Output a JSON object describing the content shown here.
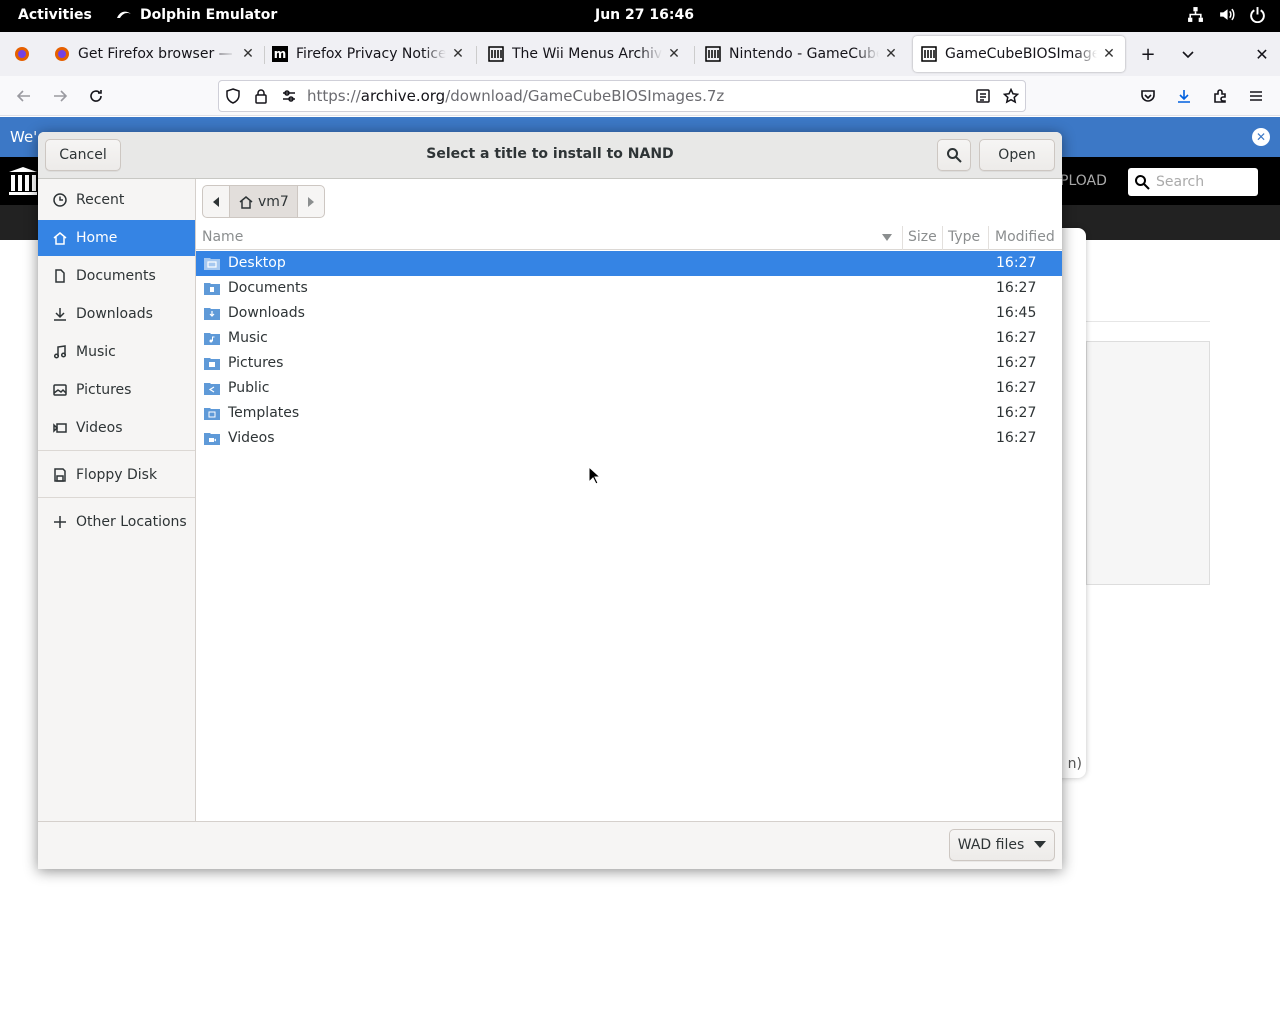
{
  "topbar": {
    "activities": "Activities",
    "app_name": "Dolphin Emulator",
    "clock": "Jun 27  16:46",
    "tray_icons": [
      "network-icon",
      "volume-icon",
      "power-icon"
    ]
  },
  "browser": {
    "tabs": [
      {
        "title": "Get Firefox browser — M",
        "icon": "firefox-icon",
        "active": false
      },
      {
        "title": "Firefox Privacy Notice —",
        "icon": "mozilla-m-icon",
        "active": false
      },
      {
        "title": "The Wii Menus Archive (",
        "icon": "archive-org-icon",
        "active": false
      },
      {
        "title": "Nintendo - GameCube -",
        "icon": "archive-org-icon",
        "active": false
      },
      {
        "title": "GameCubeBIOSImages.",
        "icon": "archive-org-icon",
        "active": true
      }
    ],
    "url_prefix": "https://",
    "url_host": "archive.org",
    "url_path": "/download/GameCubeBIOSImages.7z"
  },
  "page": {
    "notice_text": "We'",
    "upload_fragment": "PLOAD",
    "search_placeholder": "Search",
    "card_fragment": "n)"
  },
  "dialog": {
    "title": "Select a title to install to NAND",
    "cancel_label": "Cancel",
    "open_label": "Open",
    "sidebar": [
      {
        "label": "Recent",
        "icon": "clock-icon",
        "selected": false
      },
      {
        "label": "Home",
        "icon": "home-icon",
        "selected": true
      },
      {
        "label": "Documents",
        "icon": "document-icon",
        "selected": false
      },
      {
        "label": "Downloads",
        "icon": "download-icon",
        "selected": false
      },
      {
        "label": "Music",
        "icon": "music-icon",
        "selected": false
      },
      {
        "label": "Pictures",
        "icon": "picture-icon",
        "selected": false
      },
      {
        "label": "Videos",
        "icon": "video-icon",
        "selected": false
      },
      {
        "label": "Floppy Disk",
        "icon": "floppy-icon",
        "selected": false
      },
      {
        "label": "Other Locations",
        "icon": "plus-icon",
        "selected": false
      }
    ],
    "path": "vm7",
    "columns": {
      "name": "Name",
      "size": "Size",
      "type": "Type",
      "modified": "Modified"
    },
    "files": [
      {
        "name": "Desktop",
        "modified": "16:27",
        "selected": true
      },
      {
        "name": "Documents",
        "modified": "16:27",
        "selected": false
      },
      {
        "name": "Downloads",
        "modified": "16:45",
        "selected": false
      },
      {
        "name": "Music",
        "modified": "16:27",
        "selected": false
      },
      {
        "name": "Pictures",
        "modified": "16:27",
        "selected": false
      },
      {
        "name": "Public",
        "modified": "16:27",
        "selected": false
      },
      {
        "name": "Templates",
        "modified": "16:27",
        "selected": false
      },
      {
        "name": "Videos",
        "modified": "16:27",
        "selected": false
      }
    ],
    "filter": "WAD files"
  },
  "colors": {
    "accent": "#3584e4",
    "folder": "#5f9ad8",
    "notice": "#3c78c6"
  }
}
